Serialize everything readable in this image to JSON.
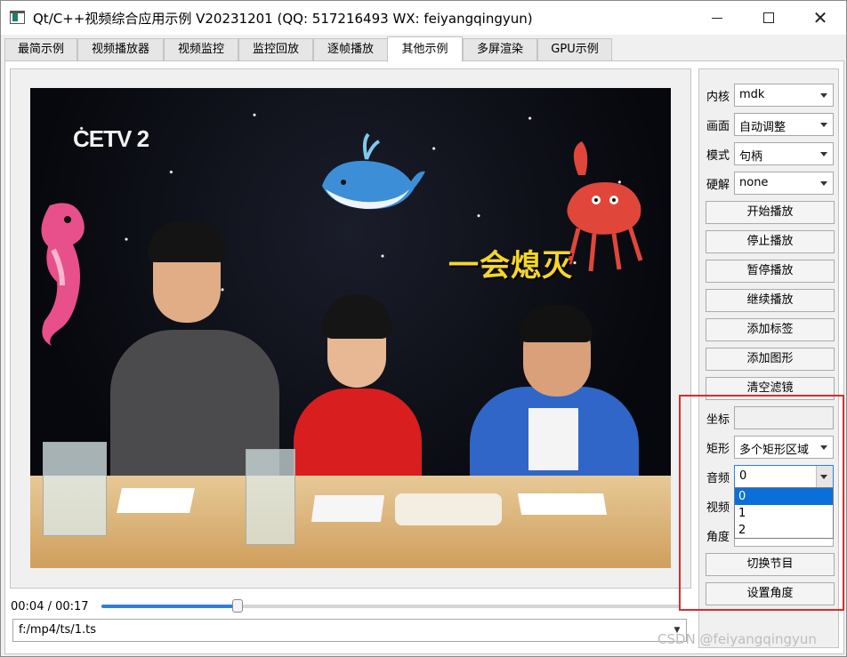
{
  "window": {
    "title": "Qt/C++视频综合应用示例 V20231201 (QQ: 517216493 WX: feiyangqingyun)"
  },
  "tabs": [
    {
      "label": "最简示例"
    },
    {
      "label": "视频播放器"
    },
    {
      "label": "视频监控"
    },
    {
      "label": "监控回放"
    },
    {
      "label": "逐帧播放"
    },
    {
      "label": "其他示例"
    },
    {
      "label": "多屏渲染"
    },
    {
      "label": "GPU示例"
    }
  ],
  "active_tab": "其他示例",
  "video": {
    "channel_logo": "CETV 2",
    "caption": "一会熄灭"
  },
  "playback": {
    "time": "00:04  /  00:17",
    "progress": 0.235,
    "url": "f:/mp4/ts/1.ts"
  },
  "panel": {
    "kernel": {
      "label": "内核",
      "value": "mdk"
    },
    "display": {
      "label": "画面",
      "value": "自动调整"
    },
    "mode": {
      "label": "模式",
      "value": "句柄"
    },
    "hwdecode": {
      "label": "硬解",
      "value": "none"
    },
    "buttons": {
      "start": "开始播放",
      "stop": "停止播放",
      "pause": "暂停播放",
      "resume": "继续播放",
      "add_label": "添加标签",
      "add_shape": "添加图形",
      "clear_filter": "清空滤镜",
      "switch_program": "切换节目",
      "set_angle": "设置角度"
    },
    "coord": {
      "label": "坐标",
      "value": ""
    },
    "rect": {
      "label": "矩形",
      "value": "多个矩形区域"
    },
    "audio": {
      "label": "音频",
      "value": "0",
      "options": [
        "0",
        "1",
        "2"
      ],
      "selected_index": 0
    },
    "video": {
      "label": "视频"
    },
    "angle": {
      "label": "角度"
    }
  },
  "watermark": "CSDN @feiyangqingyun",
  "colors": {
    "accent": "#2f7fd8",
    "selection": "#0a6fd8",
    "highlight_box": "#d32f2f",
    "caption": "#f5d62a"
  }
}
